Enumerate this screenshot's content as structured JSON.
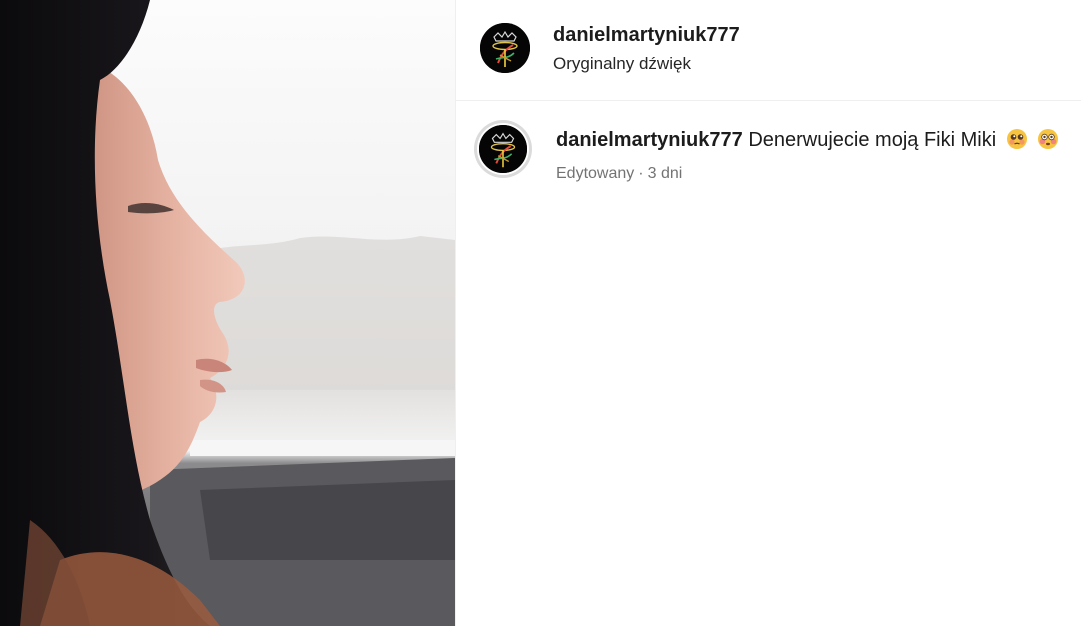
{
  "post": {
    "username": "danielmartyniuk777",
    "audio_label": "Oryginalny dźwięk",
    "avatar_icon": "crown-logo-icon",
    "media": {
      "kind": "video-frame",
      "description_icon": "video-still-icon"
    }
  },
  "comment": {
    "username": "danielmartyniuk777",
    "text": "Denerwujecie moją Fiki Miki",
    "emojis": [
      "pleading-face-icon",
      "flushed-face-icon"
    ],
    "edited_label": "Edytowany",
    "separator": "·",
    "age": "3 dni"
  },
  "colors": {
    "text_primary": "#1c1c1c",
    "text_secondary": "#737373",
    "divider": "#efefef",
    "avatar_bg": "#050505"
  }
}
